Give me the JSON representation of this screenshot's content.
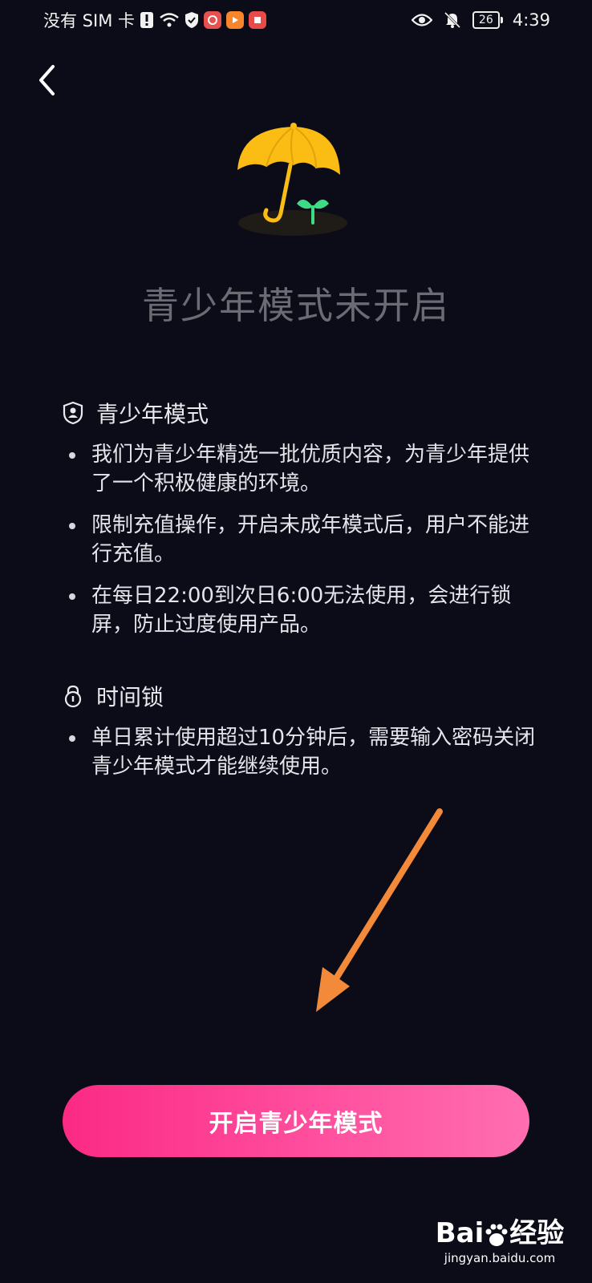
{
  "status_bar": {
    "carrier": "没有 SIM 卡",
    "battery_level": "26",
    "time": "4:39",
    "icons_left": [
      "alert-icon",
      "wifi-icon",
      "shield-check-icon",
      "app-badge-red",
      "app-badge-orange",
      "app-badge-red-book"
    ],
    "icons_right": [
      "eye-icon",
      "bell-muted-icon",
      "battery-icon"
    ]
  },
  "page": {
    "title": "青少年模式未开启"
  },
  "section_youth": {
    "title": "青少年模式",
    "icon": "shield-user-icon",
    "items": [
      "我们为青少年精选一批优质内容，为青少年提供 了一个积极健康的环境。",
      "限制充值操作，开启未成年模式后，用户不能进行充值。",
      "在每日22:00到次日6:00无法使用，会进行锁屏，防止过度使用产品。"
    ]
  },
  "section_lock": {
    "title": "时间锁",
    "icon": "lock-icon",
    "items": [
      "单日累计使用超过10分钟后，需要输入密码关闭青少年模式才能继续使用。"
    ]
  },
  "action": {
    "enable_label": "开启青少年模式"
  },
  "watermark": {
    "logo_left": "Bai",
    "logo_right": "经验",
    "url": "jingyan.baidu.com"
  },
  "colors": {
    "background": "#0c0c18",
    "button_start": "#fb2a84",
    "button_end": "#ff6eb0",
    "umbrella": "#fbbd14",
    "sprout": "#3ddc84",
    "annotation_arrow": "#f28a3a"
  }
}
